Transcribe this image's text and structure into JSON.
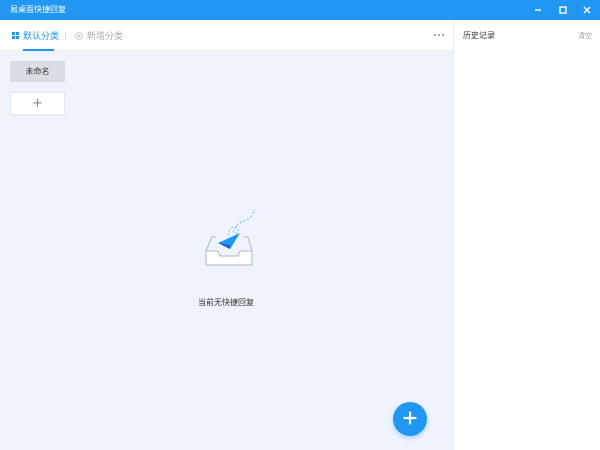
{
  "window": {
    "title": "易桌面快捷回复",
    "controls": [
      "minimize-icon",
      "maximize-icon",
      "close-icon"
    ],
    "titlebar_color": "#2196f3"
  },
  "tabs": [
    {
      "label": "默认分类",
      "icon": "grid-icon",
      "active": true
    },
    {
      "label": "新增分类",
      "icon": "plus-circle-icon",
      "active": false
    }
  ],
  "more_menu_icon": "more-dots-icon",
  "categories": [
    {
      "label": "未命名"
    }
  ],
  "add_category_symbol": "+",
  "empty_state": {
    "icon": "paper-plane-inbox-icon",
    "text": "当前无快捷回复"
  },
  "fab_icon": "plus-icon",
  "history": {
    "title": "历史记录",
    "clear_label": "清空"
  },
  "colors": {
    "accent": "#2196f3",
    "content_bg": "#eef3fc"
  }
}
